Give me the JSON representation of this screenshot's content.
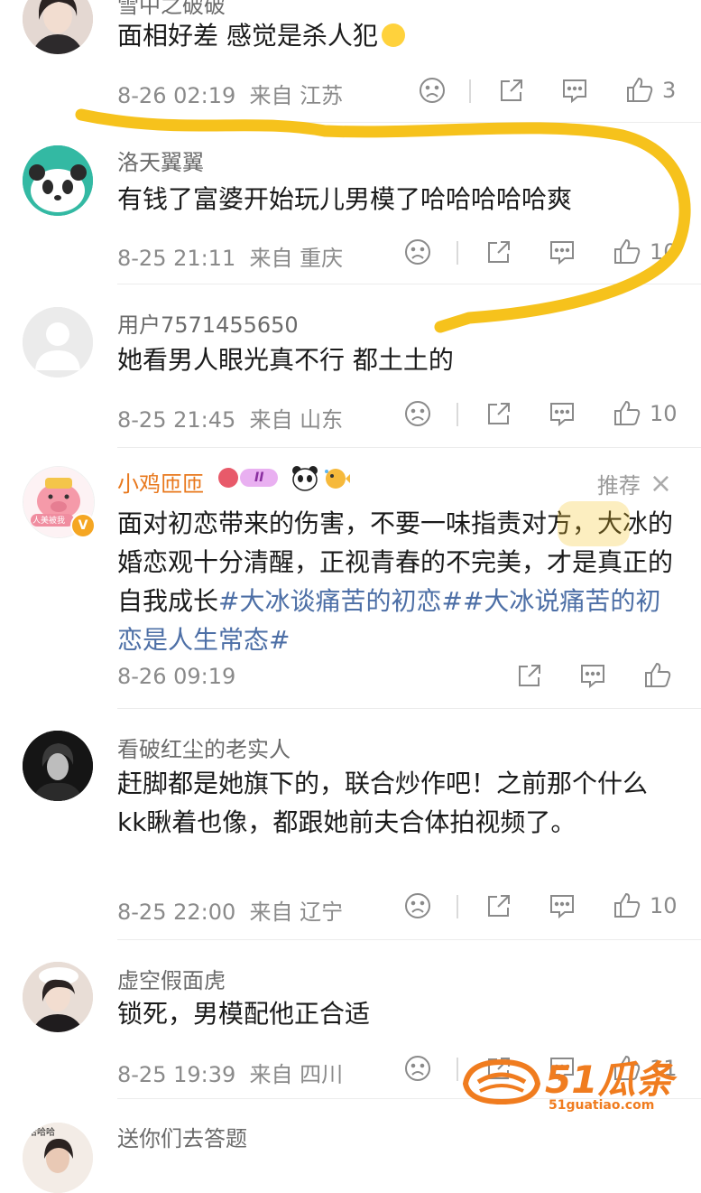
{
  "comments": [
    {
      "username": "雪中之破破",
      "text": "面相好差 感觉是杀人犯",
      "date": "8-26 02:19",
      "location": "来自 江苏",
      "likes": "3"
    },
    {
      "username": "洛天翼翼",
      "text": "有钱了富婆开始玩儿男模了哈哈哈哈哈爽",
      "date": "8-25 21:11",
      "location": "来自 重庆",
      "likes": "10"
    },
    {
      "username": "用户7571455650",
      "text": "她看男人眼光真不行 都土土的",
      "date": "8-25 21:45",
      "location": "来自 山东",
      "likes": "10"
    },
    {
      "username": "小鸡匝匝",
      "text": "面对初恋带来的伤害，不要一味指责对方，大冰的婚恋观十分清醒，正视青春的不完美，才是真正的自我成长",
      "hashtag1": "#大冰谈痛苦的初恋#",
      "hashtag2": "#大冰说痛苦的初恋是人生常态#",
      "date": "8-26 09:19",
      "recommend": "推荐",
      "level": "II",
      "avatar_label": "人美被我"
    },
    {
      "username": "看破红尘的老实人",
      "text": "赶脚都是她旗下的，联合炒作吧！之前那个什么kk瞅着也像，都跟她前夫合体拍视频了。",
      "date": "8-25 22:00",
      "location": "来自 辽宁",
      "likes": "10"
    },
    {
      "username": "虚空假面虎",
      "text": "锁死，男模配他正合适",
      "date": "8-25 19:39",
      "location": "来自 四川",
      "likes": "11"
    },
    {
      "username": "送你们去答题",
      "avatar_label": "哈哈哈"
    }
  ],
  "watermark": {
    "brand": "51瓜条",
    "url": "51guatiao.com"
  },
  "colors": {
    "highlight": "#f6c21c",
    "hashtag": "#4d6fa6",
    "vip_name": "#e8781d",
    "watermark": "#f07c1f"
  }
}
